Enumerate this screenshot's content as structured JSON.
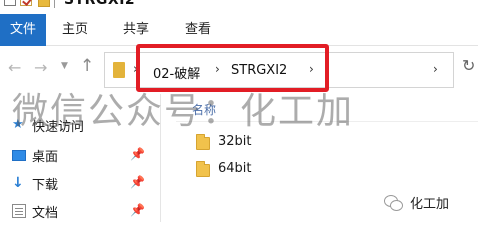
{
  "window": {
    "title": "STRGXI2"
  },
  "ribbon": {
    "tabs": [
      {
        "label": "文件"
      },
      {
        "label": "主页"
      },
      {
        "label": "共享"
      },
      {
        "label": "查看"
      }
    ]
  },
  "address_bar": {
    "crumbs": [
      {
        "label": "02-破解"
      },
      {
        "label": "STRGXI2"
      }
    ]
  },
  "watermark": {
    "text": "微信公众号：化工加"
  },
  "column_header": {
    "name": "名称"
  },
  "sidebar": {
    "items": [
      {
        "label": "快速访问",
        "icon": "star-icon"
      },
      {
        "label": "桌面",
        "icon": "desktop-icon",
        "pinned": true
      },
      {
        "label": "下载",
        "icon": "download-icon",
        "pinned": true
      },
      {
        "label": "文档",
        "icon": "document-icon",
        "pinned": true
      }
    ]
  },
  "files": [
    {
      "name": "32bit",
      "type": "folder"
    },
    {
      "name": "64bit",
      "type": "folder"
    }
  ],
  "brand": {
    "text": "化工加"
  },
  "colors": {
    "file_tab": "#1f6fc5",
    "highlight": "#e21d25",
    "folder": "#f1c24c"
  }
}
